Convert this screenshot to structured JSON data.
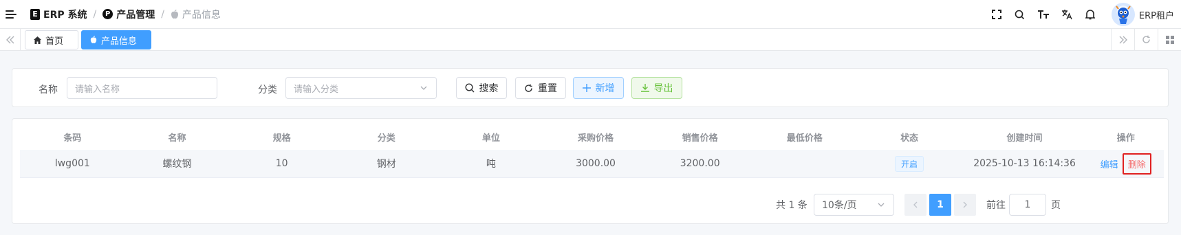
{
  "header": {
    "breadcrumb": [
      {
        "label": "ERP 系统",
        "icon": "erp-logo-icon",
        "logo_letter": "E"
      },
      {
        "label": "产品管理",
        "icon": "p-circle-icon",
        "logo_letter": "P"
      },
      {
        "label": "产品信息",
        "icon": "apple-icon"
      }
    ],
    "separator": "/",
    "tenant": "ERP租户"
  },
  "tabs": [
    {
      "label": "首页",
      "icon": "home-icon",
      "active": false
    },
    {
      "label": "产品信息",
      "icon": "apple-icon",
      "active": true
    }
  ],
  "search": {
    "name_label": "名称",
    "name_placeholder": "请输入名称",
    "category_label": "分类",
    "category_placeholder": "请输入分类",
    "search_btn": "搜索",
    "reset_btn": "重置",
    "add_btn": "新增",
    "export_btn": "导出"
  },
  "table": {
    "headers": [
      "条码",
      "名称",
      "规格",
      "分类",
      "单位",
      "采购价格",
      "销售价格",
      "最低价格",
      "状态",
      "创建时间",
      "操作"
    ],
    "rows": [
      {
        "barcode": "lwg001",
        "name": "螺纹钢",
        "spec": "10",
        "category": "钢材",
        "unit": "吨",
        "purchase_price": "3000.00",
        "sale_price": "3200.00",
        "min_price": "",
        "status": "开启",
        "created_at": "2025-10-13 16:14:36",
        "edit": "编辑",
        "delete": "删除"
      }
    ]
  },
  "pagination": {
    "total_text": "共 1 条",
    "page_size": "10条/页",
    "current_page": "1",
    "goto_label": "前往",
    "goto_value": "1",
    "page_suffix": "页"
  },
  "colors": {
    "primary": "#409eff",
    "success": "#67c23a",
    "danger": "#f56c6c",
    "highlight_box": "#e02020"
  }
}
